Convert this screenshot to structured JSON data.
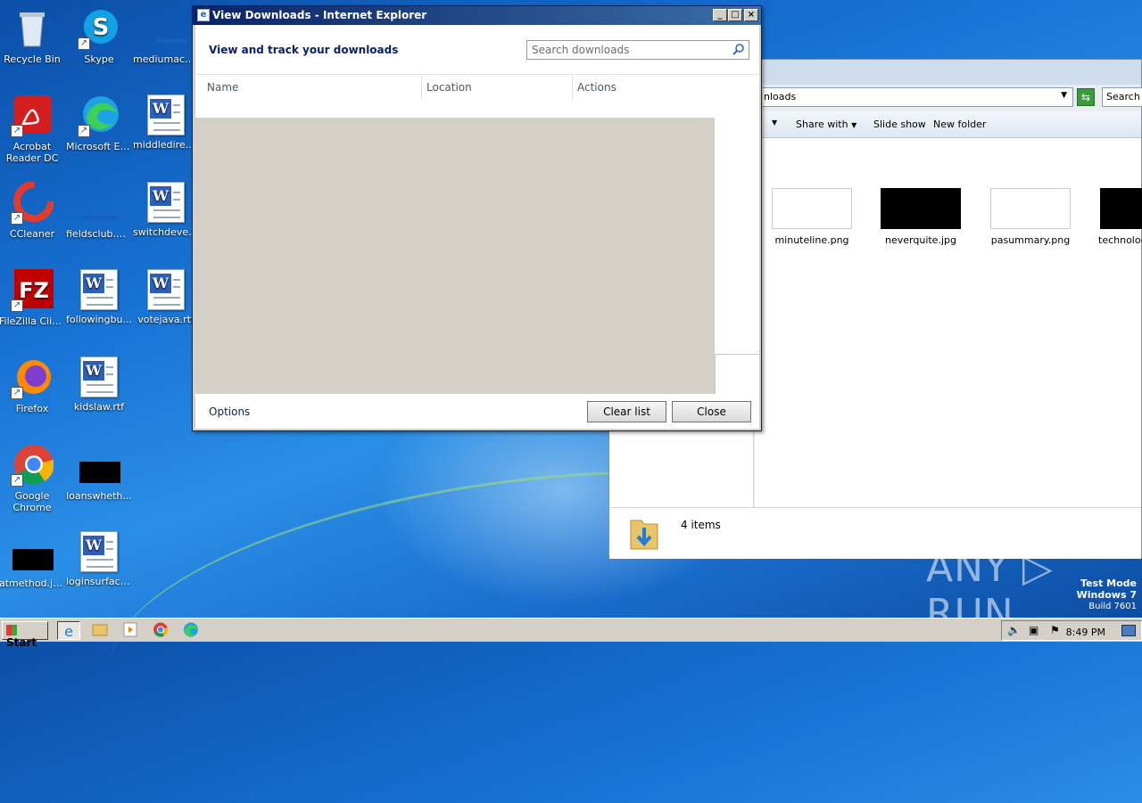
{
  "desktop": {
    "icons": [
      {
        "label": "Recycle Bin",
        "kind": "recycle"
      },
      {
        "label": "Skype",
        "kind": "skype"
      },
      {
        "label": "mediumacc...",
        "kind": "blue-thumb"
      },
      {
        "label": "Acrobat Reader DC",
        "kind": "acrobat"
      },
      {
        "label": "Microsoft Edge",
        "kind": "edge"
      },
      {
        "label": "middledirec...",
        "kind": "word"
      },
      {
        "label": "CCleaner",
        "kind": "ccleaner"
      },
      {
        "label": "fieldsclub.png",
        "kind": "blue-thumb"
      },
      {
        "label": "switchdevel...",
        "kind": "word"
      },
      {
        "label": "FileZilla Client",
        "kind": "filezilla"
      },
      {
        "label": "followingbu...",
        "kind": "word"
      },
      {
        "label": "votejava.rtf",
        "kind": "word"
      },
      {
        "label": "Firefox",
        "kind": "firefox"
      },
      {
        "label": "kidslaw.rtf",
        "kind": "word"
      },
      {
        "label": "Google Chrome",
        "kind": "chrome"
      },
      {
        "label": "loanswheth...",
        "kind": "black-thumb"
      },
      {
        "label": "atmethod.jpg",
        "kind": "black-thumb"
      },
      {
        "label": "loginsurface...",
        "kind": "word"
      }
    ]
  },
  "explorer": {
    "address": "nloads",
    "search_placeholder": "Search D",
    "commands": {
      "share_with": "Share with",
      "slide_show": "Slide show",
      "new_folder": "New folder"
    },
    "files": [
      {
        "name": "minuteline.png",
        "thumb": "white"
      },
      {
        "name": "neverquite.jpg",
        "thumb": "black"
      },
      {
        "name": "pasummary.png",
        "thumb": "white"
      },
      {
        "name": "technolog",
        "thumb": "black"
      }
    ],
    "item_count": "4 items"
  },
  "ie_dialog": {
    "title": "View Downloads - Internet Explorer",
    "heading": "View and track your downloads",
    "search_placeholder": "Search downloads",
    "columns": {
      "name": "Name",
      "location": "Location",
      "actions": "Actions"
    },
    "options_label": "Options",
    "clear_list_label": "Clear list",
    "close_label": "Close"
  },
  "taskbar": {
    "start_label": "Start",
    "clock": "8:49 PM"
  },
  "watermark": "ANY ▷ RUN",
  "test_mode": {
    "line1": "Test Mode",
    "line2": "Windows 7",
    "line3": "Build 7601"
  }
}
